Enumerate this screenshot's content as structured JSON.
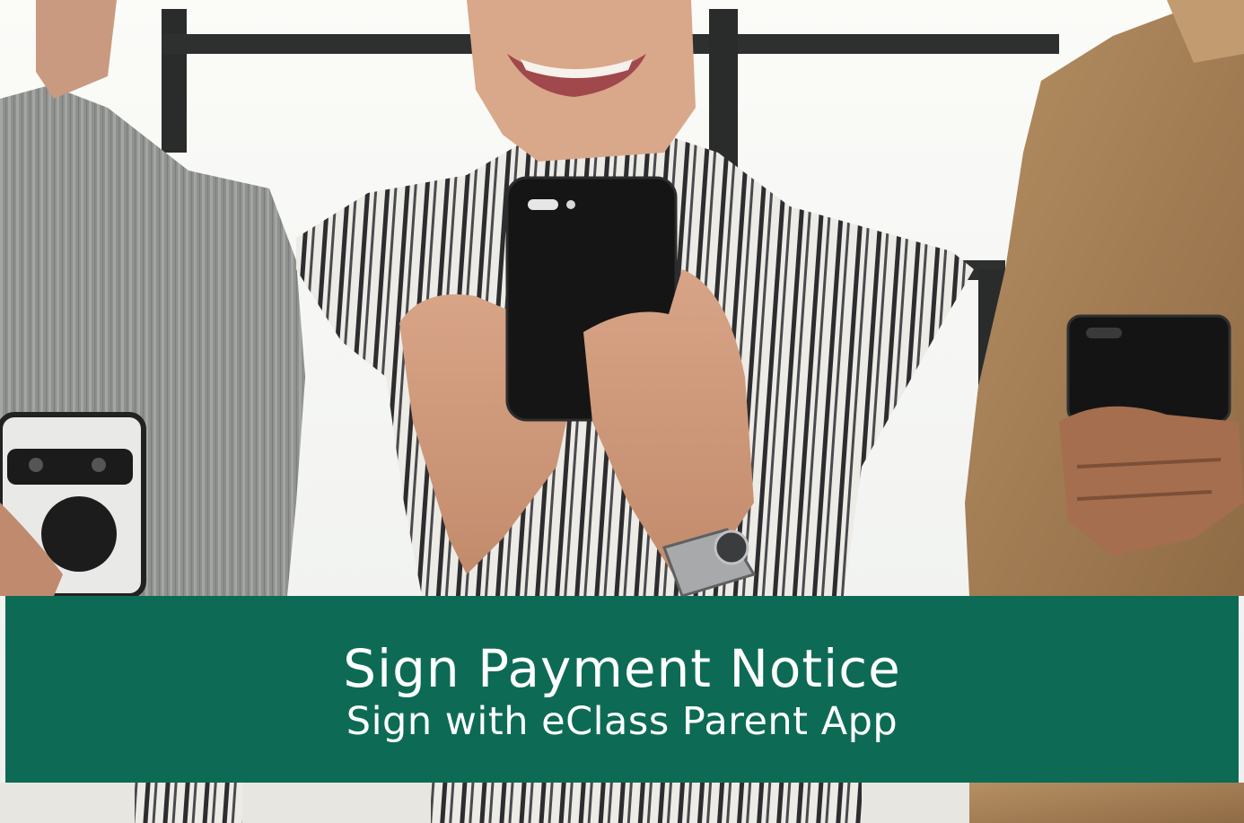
{
  "banner": {
    "title": "Sign Payment Notice",
    "subtitle": "Sign with eClass Parent App"
  },
  "colors": {
    "banner_background": "#0d6b55",
    "banner_text": "#ffffff"
  }
}
